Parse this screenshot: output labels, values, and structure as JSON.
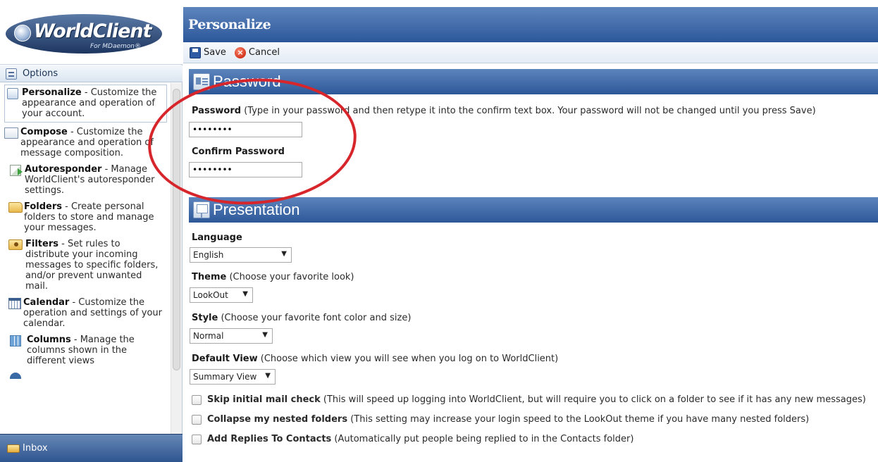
{
  "logo": {
    "text": "WorldClient",
    "subtext": "For MDaemon®"
  },
  "sidebar": {
    "header_label": "Options",
    "items": [
      {
        "title": "Personalize",
        "desc": " - Customize the appearance and operation of your account.",
        "icon": "personalize-icon"
      },
      {
        "title": "Compose",
        "desc": " - Customize the appearance and operation of message composition.",
        "icon": "compose-icon"
      },
      {
        "title": "Autoresponder",
        "desc": " - Manage WorldClient's autoresponder settings.",
        "icon": "autoresponder-icon"
      },
      {
        "title": "Folders",
        "desc": " - Create personal folders to store and manage your messages.",
        "icon": "folder-icon"
      },
      {
        "title": "Filters",
        "desc": " - Set rules to distribute your incoming messages to specific folders, and/or prevent unwanted mail.",
        "icon": "filter-icon"
      },
      {
        "title": "Calendar",
        "desc": " - Customize the operation and settings of your calendar.",
        "icon": "calendar-icon"
      },
      {
        "title": "Columns",
        "desc": " - Manage the columns shown in the different views",
        "icon": "columns-icon"
      }
    ],
    "inbox_label": "Inbox"
  },
  "header": {
    "title": "Personalize"
  },
  "toolbar": {
    "save_label": "Save",
    "cancel_label": "Cancel"
  },
  "password_section": {
    "title": "Password",
    "password_label": "Password",
    "password_hint": " (Type in your password and then retype it into the confirm text box. Your password will not be changed until you press Save)",
    "password_value": "••••••••",
    "confirm_label": "Confirm Password",
    "confirm_value": "••••••••"
  },
  "presentation_section": {
    "title": "Presentation",
    "language_label": "Language",
    "language_value": "English",
    "theme_label": "Theme",
    "theme_hint": " (Choose your favorite look)",
    "theme_value": "LookOut",
    "style_label": "Style",
    "style_hint": " (Choose your favorite font color and size)",
    "style_value": "Normal",
    "default_view_label": "Default View",
    "default_view_hint": " (Choose which view you will see when you log on to WorldClient)",
    "default_view_value": "Summary View",
    "checks": [
      {
        "label": "Skip initial mail check",
        "hint": " (This will speed up logging into WorldClient, but will require you to click on a folder to see if it has any new messages)",
        "checked": false
      },
      {
        "label": "Collapse my nested folders",
        "hint": " (This setting may increase your login speed to the LookOut theme if you have many nested folders)",
        "checked": false
      },
      {
        "label": "Add Replies To Contacts",
        "hint": " (Automatically put people being replied to in the Contacts folder)",
        "checked": false
      }
    ]
  },
  "colors": {
    "header_blue": "#2b579a",
    "annotation_red": "#d7262b"
  }
}
